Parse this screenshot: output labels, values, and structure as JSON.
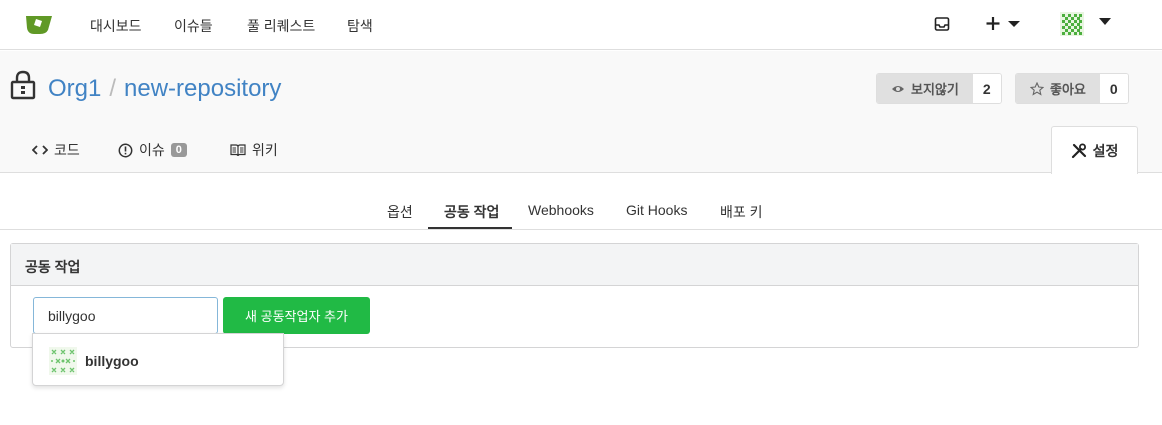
{
  "topnav": {
    "items": [
      "대시보드",
      "이슈들",
      "풀 리퀘스트",
      "탐색"
    ]
  },
  "repo": {
    "owner": "Org1",
    "separator": "/",
    "name": "new-repository",
    "watch_label": "보지않기",
    "watch_count": "2",
    "star_label": "좋아요",
    "star_count": "0",
    "tabs": {
      "code": "코드",
      "issues": "이슈",
      "issues_count": "0",
      "wiki": "위키",
      "settings": "설정"
    }
  },
  "settings_tabs": [
    "옵션",
    "공동 작업",
    "Webhooks",
    "Git Hooks",
    "배포 키"
  ],
  "collaboration": {
    "header": "공동 작업",
    "search_value": "billygoo",
    "add_button": "새 공동작업자 추가",
    "suggestion": "billygoo"
  },
  "colors": {
    "accent": "#4183c4",
    "add_button": "#21ba45",
    "logo": "#609926"
  }
}
